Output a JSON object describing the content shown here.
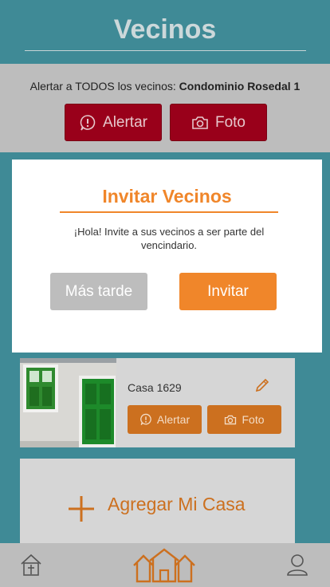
{
  "header": {
    "title": "Vecinos"
  },
  "alert_panel": {
    "prefix": "Alertar a TODOS los vecinos: ",
    "community": "Condominio Rosedal 1",
    "alert_label": "Alertar",
    "photo_label": "Foto"
  },
  "modal": {
    "title": "Invitar Vecinos",
    "message": "¡Hola! Invite a sus vecinos a ser parte del vencindario.",
    "later_label": "Más tarde",
    "invite_label": "Invitar"
  },
  "house": {
    "name": "Casa 1629",
    "alert_label": "Alertar",
    "photo_label": "Foto"
  },
  "add_house": {
    "label": "Agregar Mi Casa"
  },
  "colors": {
    "teal": "#3f8a96",
    "orange": "#f0862a",
    "dark_red": "#99001a",
    "gray": "#bdbdbd"
  },
  "icons": {
    "nav_left": "church-icon",
    "nav_center": "houses-icon",
    "nav_right": "user-icon"
  }
}
